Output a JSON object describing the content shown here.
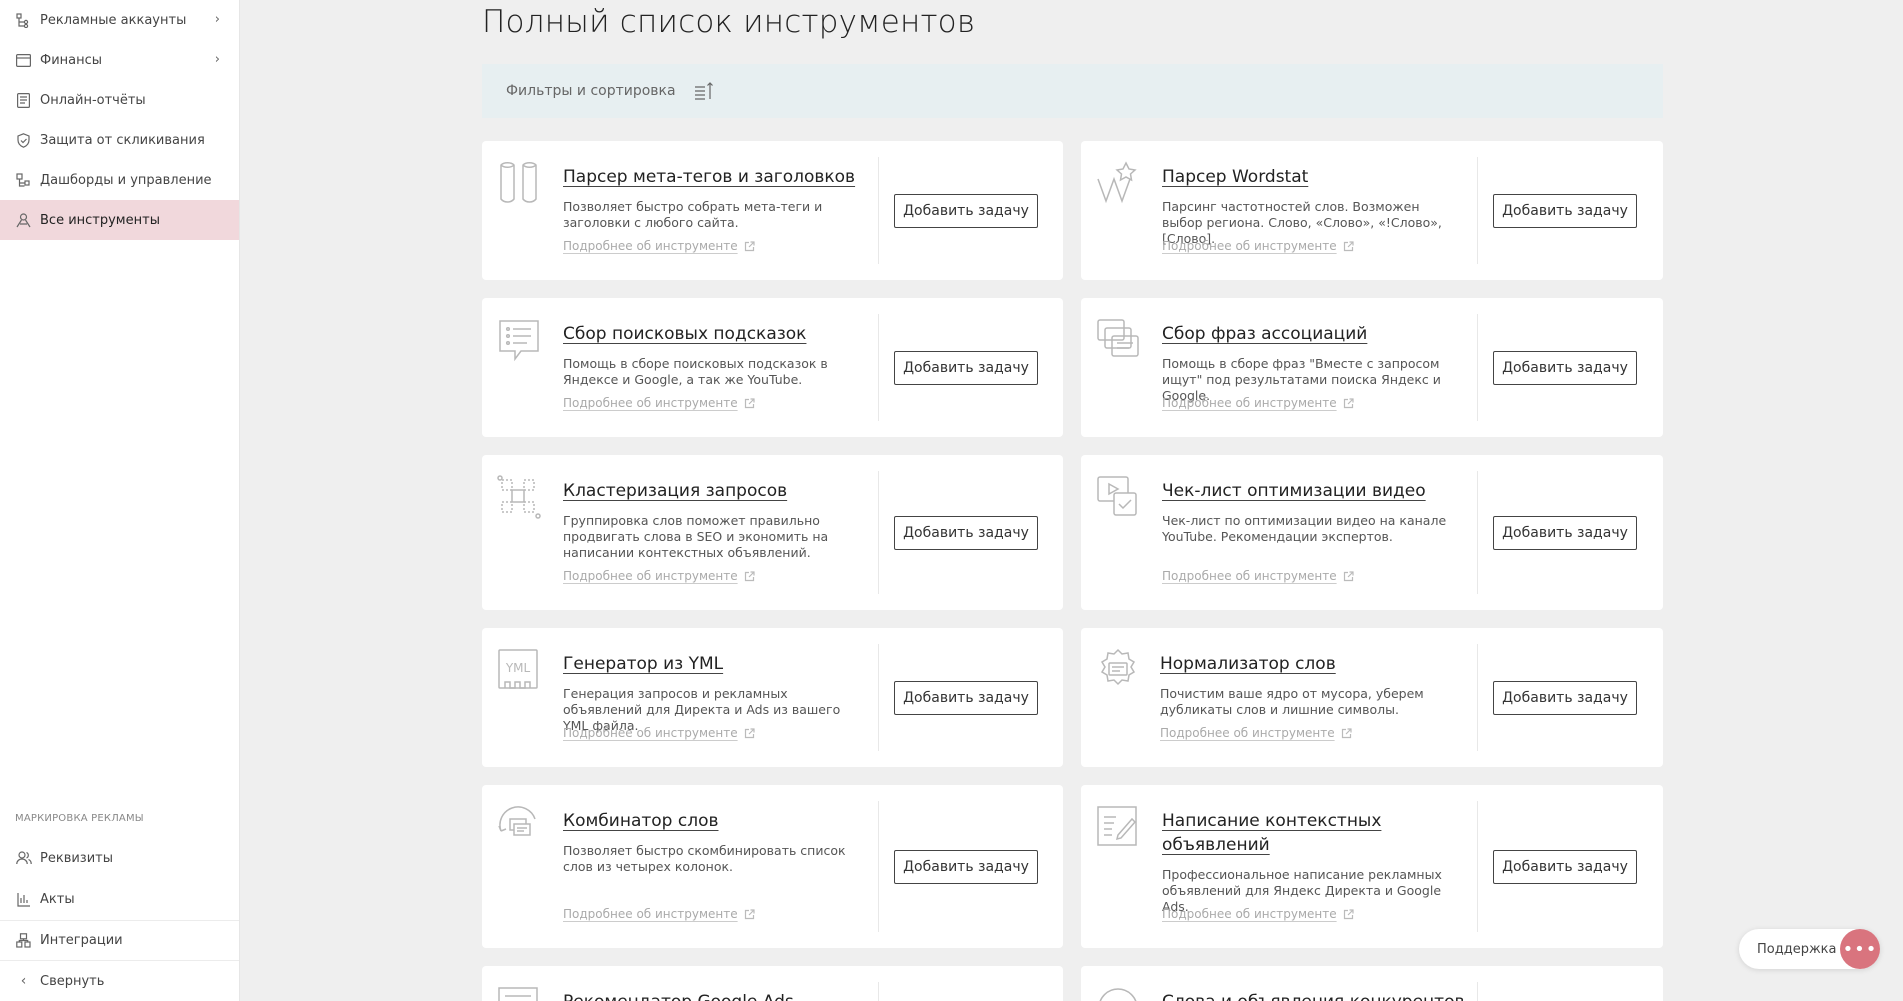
{
  "sidebar": {
    "items": [
      {
        "label": "Рекламные аккаунты",
        "icon": "ad-accounts-icon",
        "chevron": true
      },
      {
        "label": "Финансы",
        "icon": "wallet-icon",
        "chevron": true
      },
      {
        "label": "Онлайн-отчёты",
        "icon": "report-icon"
      },
      {
        "label": "Защита от скликивания",
        "icon": "shield-icon"
      },
      {
        "label": "Дашборды и управление",
        "icon": "dashboard-icon"
      },
      {
        "label": "Все инструменты",
        "icon": "tools-icon",
        "active": true
      }
    ],
    "section_label": "МАРКИРОВКА РЕКЛАМЫ",
    "marking_items": [
      {
        "label": "Реквизиты",
        "icon": "users-icon"
      },
      {
        "label": "Акты",
        "icon": "document-icon"
      }
    ],
    "integrations_label": "Интеграции",
    "collapse_label": "Свернуть"
  },
  "page_title": "Полный список инструментов",
  "filter_bar": {
    "label": "Фильтры и сортировка"
  },
  "more_link_label": "Подробнее об инструменте",
  "add_task_label": "Добавить задачу",
  "tools": [
    {
      "title": "Парсер мета-тегов и заголовков",
      "desc": "Позволяет быстро собрать мета-теги и заголовки с любого сайта.",
      "icon": "parser-meta-icon"
    },
    {
      "title": "Парсер Wordstat",
      "desc": "Парсинг частотностей слов. Возможен выбор региона. Слово, «Слово», «!Слово», [Слово].",
      "icon": "wordstat-icon"
    },
    {
      "title": "Сбор поисковых подсказок",
      "desc": "Помощь в сборе поисковых подсказок в Яндексе и Google, а так же YouTube.",
      "icon": "search-hints-icon"
    },
    {
      "title": "Сбор фраз ассоциаций",
      "desc": "Помощь в сборе фраз \"Вместе с запросом ищут\" под результатами поиска Яндекс и Google.",
      "icon": "associations-icon"
    },
    {
      "title": "Кластеризация запросов",
      "desc": "Группировка слов поможет правильно продвигать слова в SEO и экономить на написании контекстных объявлений.",
      "icon": "clustering-icon"
    },
    {
      "title": "Чек-лист оптимизации видео",
      "desc": "Чек-лист по оптимизации видео на канале YouTube. Рекомендации экспертов.",
      "icon": "video-checklist-icon"
    },
    {
      "title": "Генератор из YML",
      "desc": "Генерация запросов и рекламных объявлений для Директа и Ads из вашего YML файла.",
      "icon": "yml-icon"
    },
    {
      "title": "Нормализатор слов",
      "desc": "Почистим ваше ядро от мусора, уберем дубликаты слов и лишние символы.",
      "icon": "normalizer-icon"
    },
    {
      "title": "Комбинатор слов",
      "desc": "Позволяет быстро скомбинировать список слов из четырех колонок.",
      "icon": "combinator-icon"
    },
    {
      "title": "Написание контекстных объявлений",
      "desc": "Профессиональное написание рекламных объявлений для Яндекс Директа и Google Ads.",
      "icon": "ad-writing-icon"
    },
    {
      "title": "Рекомендатор Google Ads",
      "desc": "",
      "icon": "google-ads-icon"
    },
    {
      "title": "Слова и объявления конкурентов",
      "desc": "",
      "icon": "competitors-icon"
    }
  ],
  "support": {
    "label": "Поддержка"
  },
  "colors": {
    "active_nav": "#f1d8dc",
    "filter_bg": "#e7eff1",
    "support_accent": "#d9747e",
    "page_bg": "#efefef"
  }
}
